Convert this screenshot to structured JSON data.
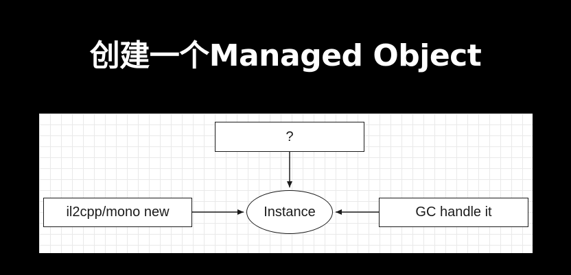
{
  "title": "创建一个Managed Object",
  "diagram": {
    "nodes": {
      "top": "?",
      "left": "il2cpp/mono new",
      "center": "Instance",
      "right": "GC handle it"
    },
    "edges": [
      {
        "from": "top",
        "to": "center"
      },
      {
        "from": "left",
        "to": "center"
      },
      {
        "from": "right",
        "to": "center"
      }
    ]
  }
}
